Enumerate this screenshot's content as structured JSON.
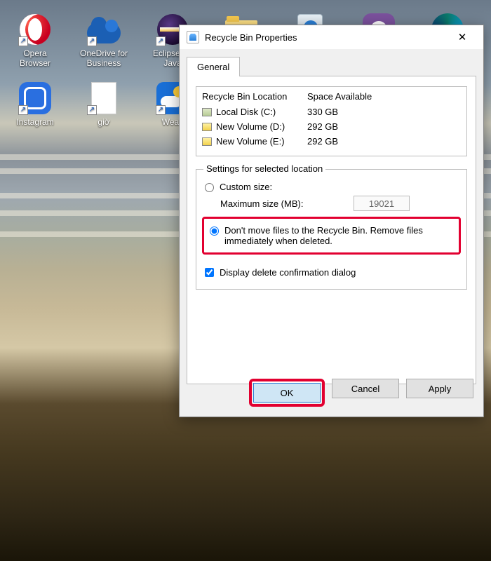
{
  "desktop_icons": [
    {
      "name": "opera",
      "label": "Opera Browser"
    },
    {
      "name": "onedrive",
      "label": "OneDrive for Business"
    },
    {
      "name": "eclipse",
      "label": "Eclipse for Java"
    },
    {
      "name": "folder",
      "label": ""
    },
    {
      "name": "recyclebin",
      "label": ""
    },
    {
      "name": "viber",
      "label": ""
    },
    {
      "name": "edge",
      "label": ""
    },
    {
      "name": "instagram",
      "label": "Instagram"
    },
    {
      "name": "file",
      "label": "giờ"
    },
    {
      "name": "weather",
      "label": "Weatl"
    }
  ],
  "dialog": {
    "title": "Recycle Bin Properties",
    "tab_general": "General",
    "loc_header": {
      "location": "Recycle Bin Location",
      "space": "Space Available"
    },
    "drives": [
      {
        "name": "Local Disk (C:)",
        "space": "330 GB"
      },
      {
        "name": "New Volume (D:)",
        "space": "292 GB"
      },
      {
        "name": "New Volume (E:)",
        "space": "292 GB"
      }
    ],
    "settings_legend": "Settings for selected location",
    "custom_size_label": "Custom size:",
    "max_size_label": "Maximum size (MB):",
    "max_size_value": "19021",
    "dont_move_label": "Don't move files to the Recycle Bin. Remove files immediately when deleted.",
    "display_confirm_label": "Display delete confirmation dialog",
    "buttons": {
      "ok": "OK",
      "cancel": "Cancel",
      "apply": "Apply"
    }
  }
}
